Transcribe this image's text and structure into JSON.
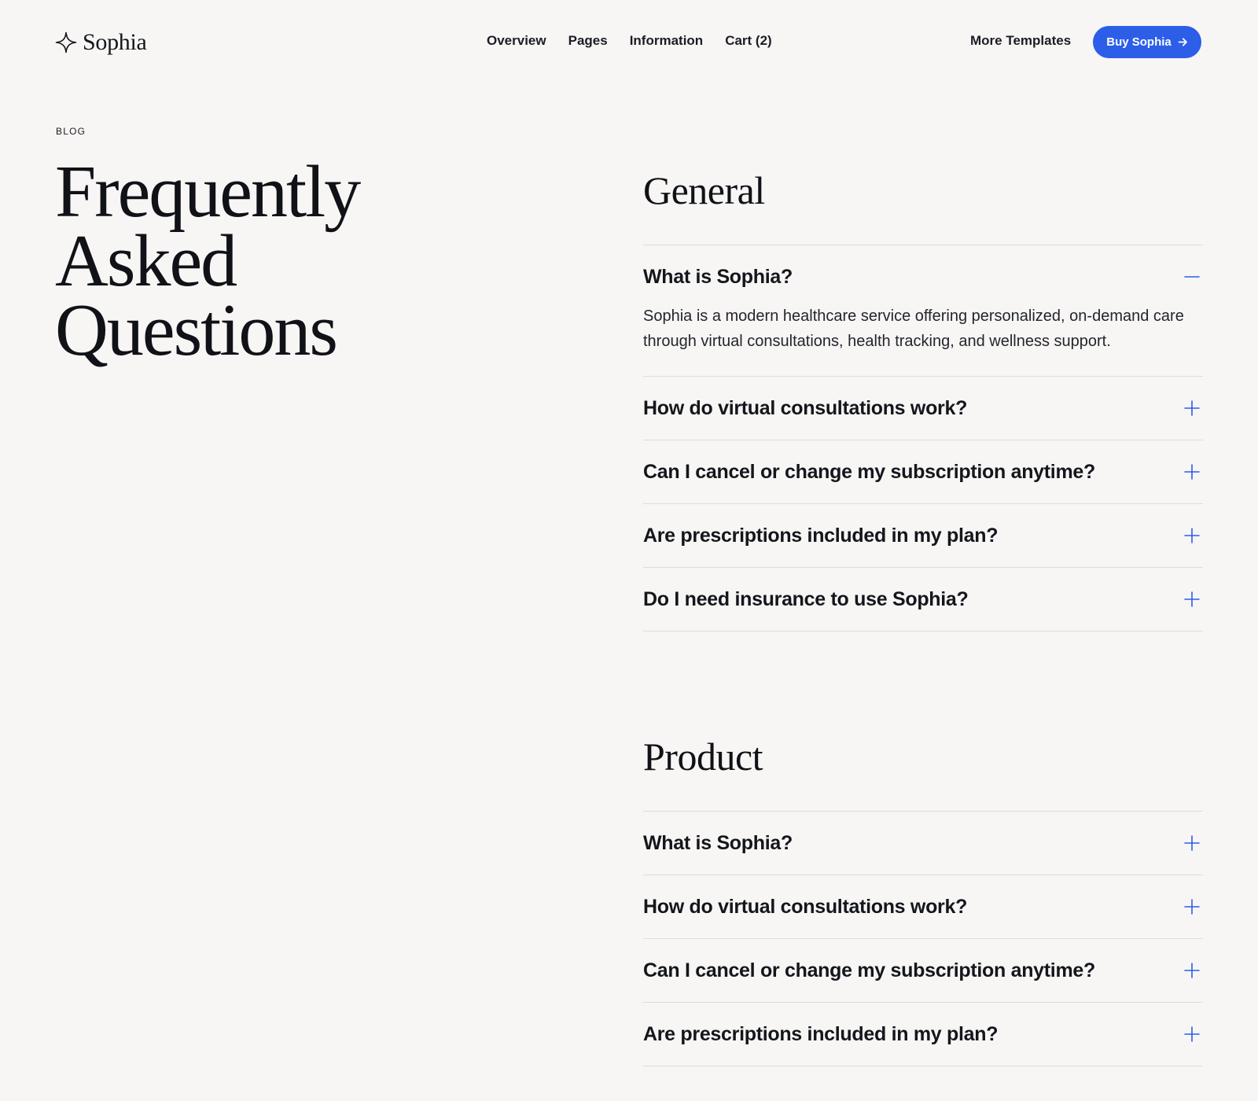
{
  "header": {
    "logo_text": "Sophia",
    "nav": [
      "Overview",
      "Pages",
      "Information",
      "Cart (2)"
    ],
    "more_templates": "More Templates",
    "buy_button": "Buy Sophia",
    "accent_color": "#2c5ee8"
  },
  "hero": {
    "eyebrow": "BLOG",
    "title_lines": [
      "Frequently",
      "Asked",
      "Questions"
    ]
  },
  "sections": [
    {
      "title": "General",
      "items": [
        {
          "question": "What is Sophia?",
          "answer": "Sophia is a modern healthcare service offering personalized, on-demand care through virtual consultations, health tracking, and wellness support.",
          "expanded": true
        },
        {
          "question": "How do virtual consultations work?",
          "expanded": false
        },
        {
          "question": "Can I cancel or change my subscription anytime?",
          "expanded": false
        },
        {
          "question": "Are prescriptions included in my plan?",
          "expanded": false
        },
        {
          "question": "Do I need insurance to use Sophia?",
          "expanded": false
        }
      ]
    },
    {
      "title": "Product",
      "items": [
        {
          "question": "What is Sophia?",
          "expanded": false
        },
        {
          "question": "How do virtual consultations work?",
          "expanded": false
        },
        {
          "question": "Can I cancel or change my subscription anytime?",
          "expanded": false
        },
        {
          "question": "Are prescriptions included in my plan?",
          "expanded": false
        }
      ]
    }
  ],
  "icons": {
    "logo": "sparkle-icon",
    "buy_button": "arrow-right-icon",
    "expanded": "minus-icon",
    "collapsed": "plus-icon"
  }
}
